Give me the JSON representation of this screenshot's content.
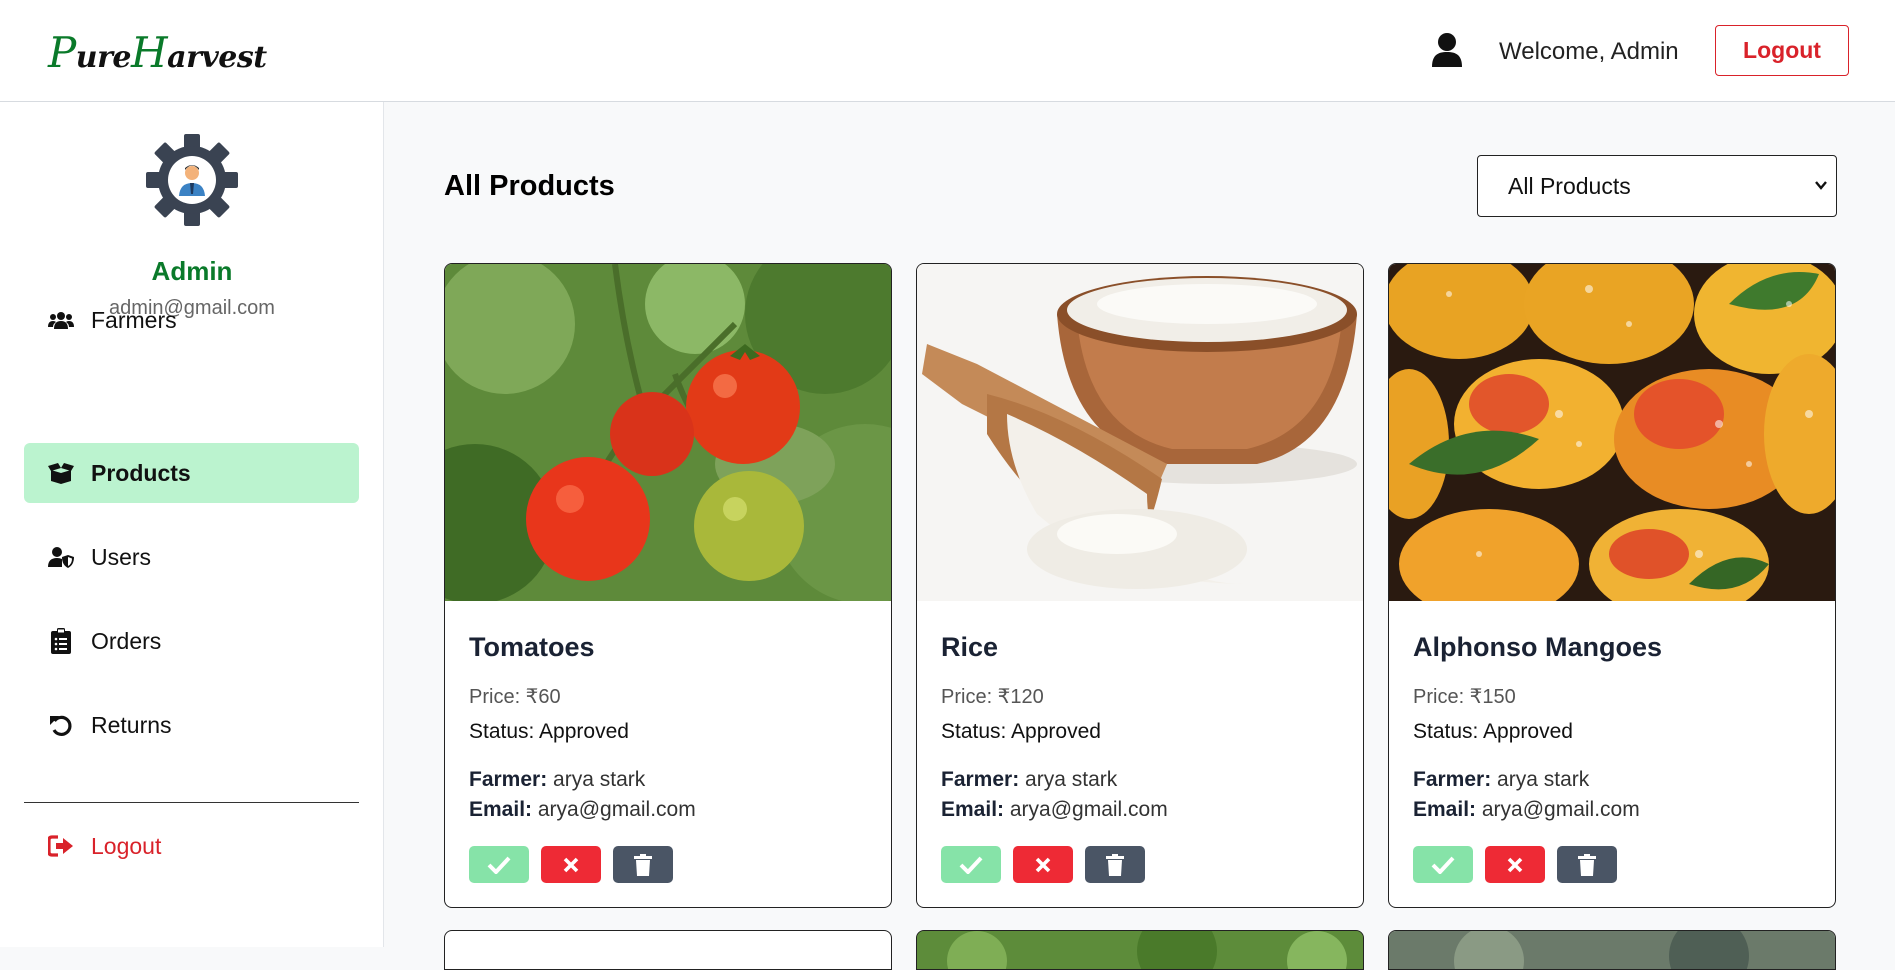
{
  "header": {
    "logo_first_cap": "P",
    "logo_first_rest": "ure",
    "logo_second_cap": "H",
    "logo_second_rest": "arvest",
    "welcome_text": "Welcome, Admin",
    "logout_label": "Logout",
    "icons": {
      "user": "user-icon"
    }
  },
  "sidebar": {
    "admin_name": "Admin",
    "admin_email": "admin@gmail.com",
    "items": [
      {
        "label": "Farmers",
        "icon": "users-icon",
        "active": false
      },
      {
        "label": "Products",
        "icon": "box-open-icon",
        "active": true
      },
      {
        "label": "Users",
        "icon": "user-shield-icon",
        "active": false
      },
      {
        "label": "Orders",
        "icon": "clipboard-list-icon",
        "active": false
      },
      {
        "label": "Returns",
        "icon": "undo-icon",
        "active": false
      }
    ],
    "logout_label": "Logout",
    "logout_icon": "sign-out-icon"
  },
  "main": {
    "title": "All Products",
    "filter": {
      "selected": "All Products"
    },
    "products": [
      {
        "name": "Tomatoes",
        "price": "Price: ₹60",
        "status": "Status: Approved",
        "farmer_label": "Farmer:",
        "farmer": "arya stark",
        "email_label": "Email:",
        "email": "arya@gmail.com"
      },
      {
        "name": "Rice",
        "price": "Price: ₹120",
        "status": "Status: Approved",
        "farmer_label": "Farmer:",
        "farmer": "arya stark",
        "email_label": "Email:",
        "email": "arya@gmail.com"
      },
      {
        "name": "Alphonso Mangoes",
        "price": "Price: ₹150",
        "status": "Status: Approved",
        "farmer_label": "Farmer:",
        "farmer": "arya stark",
        "email_label": "Email:",
        "email": "arya@gmail.com"
      }
    ]
  },
  "colors": {
    "brand_green": "#0a7a2a",
    "active_nav_bg": "#bbf3cf",
    "danger_red": "#d9222a",
    "approve_green": "#86e3a8",
    "delete_gray": "#4a5565"
  }
}
